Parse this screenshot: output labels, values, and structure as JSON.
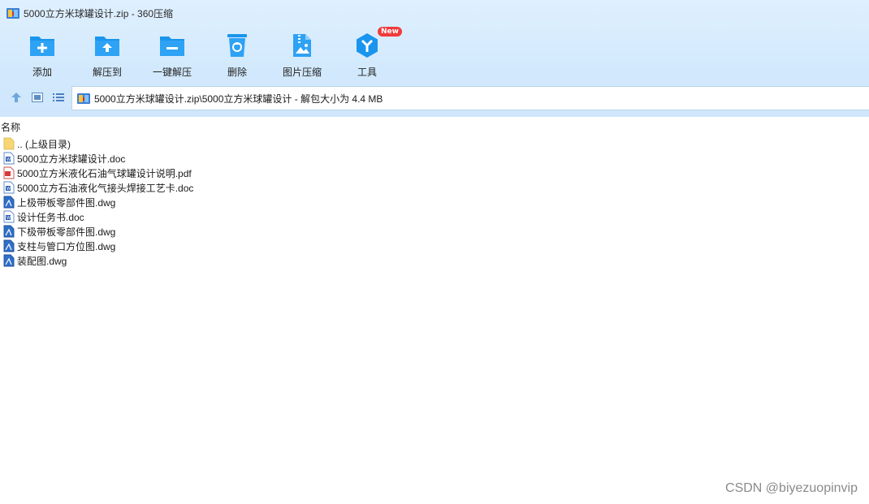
{
  "window": {
    "title": "5000立方米球罐设计.zip - 360压缩"
  },
  "colors": {
    "accent": "#1a95ee",
    "chrome_bg": "#d2e9fd",
    "badge": "#f03a3a"
  },
  "toolbar": {
    "items": [
      {
        "id": "add",
        "label": "添加",
        "icon": "add-folder-icon"
      },
      {
        "id": "extract-to",
        "label": "解压到",
        "icon": "extract-folder-icon"
      },
      {
        "id": "one-click-extract",
        "label": "一键解压",
        "icon": "one-click-extract-icon"
      },
      {
        "id": "delete",
        "label": "删除",
        "icon": "recycle-bin-icon"
      },
      {
        "id": "image-compress",
        "label": "图片压缩",
        "icon": "image-compress-icon"
      },
      {
        "id": "tools",
        "label": "工具",
        "icon": "tools-icon",
        "badge": "New"
      }
    ]
  },
  "nav": {
    "buttons": [
      "up-arrow-icon",
      "thumbnail-view-icon",
      "list-view-icon"
    ],
    "address": "5000立方米球罐设计.zip\\5000立方米球罐设计 - 解包大小为 4.4 MB"
  },
  "columns": {
    "name": "名称"
  },
  "files": [
    {
      "name": ".. (上级目录)",
      "type": "folder"
    },
    {
      "name": "5000立方米球罐设计.doc",
      "type": "doc"
    },
    {
      "name": "5000立方米液化石油气球罐设计说明.pdf",
      "type": "pdf"
    },
    {
      "name": "5000立方石油液化气接头焊接工艺卡.doc",
      "type": "doc"
    },
    {
      "name": "上极带板零部件图.dwg",
      "type": "dwg"
    },
    {
      "name": "设计任务书.doc",
      "type": "doc"
    },
    {
      "name": "下极带板零部件图.dwg",
      "type": "dwg"
    },
    {
      "name": "支柱与管口方位图.dwg",
      "type": "dwg"
    },
    {
      "name": "装配图.dwg",
      "type": "dwg"
    }
  ],
  "watermark": "CSDN @biyezuopinvip"
}
